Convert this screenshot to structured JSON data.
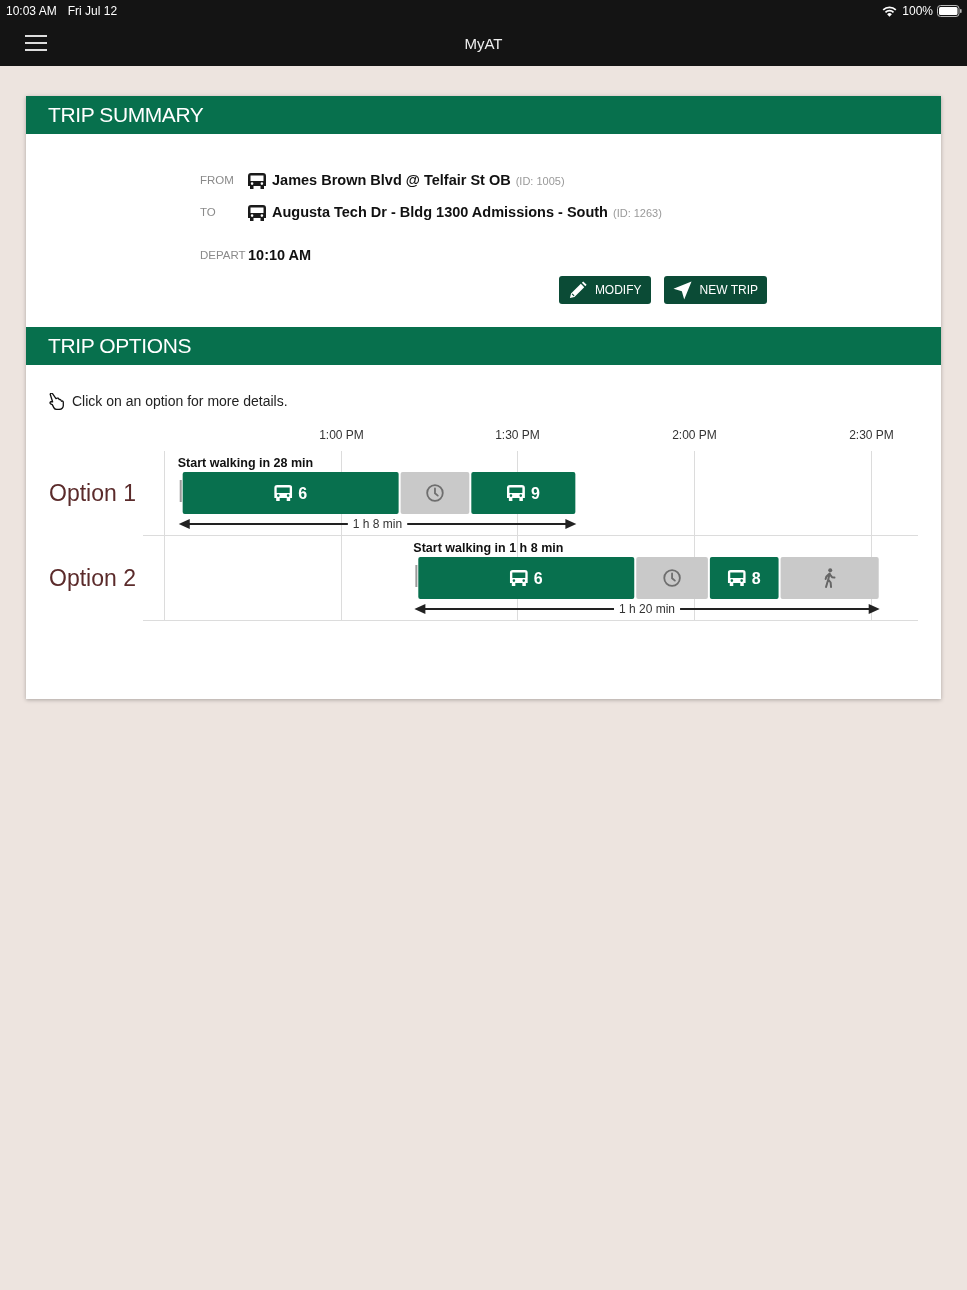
{
  "status_bar": {
    "time": "10:03 AM",
    "date": "Fri Jul 12",
    "battery": "100%"
  },
  "nav_bar": {
    "title": "MyAT"
  },
  "trip_summary": {
    "title": "TRIP SUMMARY",
    "rows": [
      {
        "label": "FROM",
        "kind": "stop",
        "value": "James Brown Blvd @ Telfair St OB",
        "id": "(ID: 1005)"
      },
      {
        "label": "TO",
        "kind": "stop",
        "value": "Augusta Tech Dr - Bldg 1300 Admissions - South",
        "id": "(ID: 1263)"
      },
      {
        "label": "DEPART",
        "kind": "time",
        "value": "10:10 AM"
      }
    ],
    "buttons": [
      {
        "label": "MODIFY",
        "kind": "edit"
      },
      {
        "label": "NEW TRIP",
        "kind": "navigate"
      }
    ]
  },
  "trip_options": {
    "title": "TRIP OPTIONS",
    "hint": "Click on an option for more details.",
    "timeline": {
      "ticks": [
        "1:00 PM",
        "1:30 PM",
        "2:00 PM",
        "2:30 PM"
      ],
      "options": [
        {
          "label": "Option 1",
          "note": "Start walking in 28 min",
          "duration": "1 h 8 min",
          "segments": [
            {
              "kind": "walk"
            },
            {
              "kind": "bus",
              "route": "6"
            },
            {
              "kind": "wait"
            },
            {
              "kind": "bus",
              "route": "9"
            }
          ]
        },
        {
          "label": "Option 2",
          "note": "Start walking in 1 h 8 min",
          "duration": "1 h 20 min",
          "segments": [
            {
              "kind": "walk"
            },
            {
              "kind": "bus",
              "route": "6"
            },
            {
              "kind": "wait"
            },
            {
              "kind": "bus",
              "route": "8"
            },
            {
              "kind": "walk"
            }
          ]
        }
      ]
    }
  }
}
